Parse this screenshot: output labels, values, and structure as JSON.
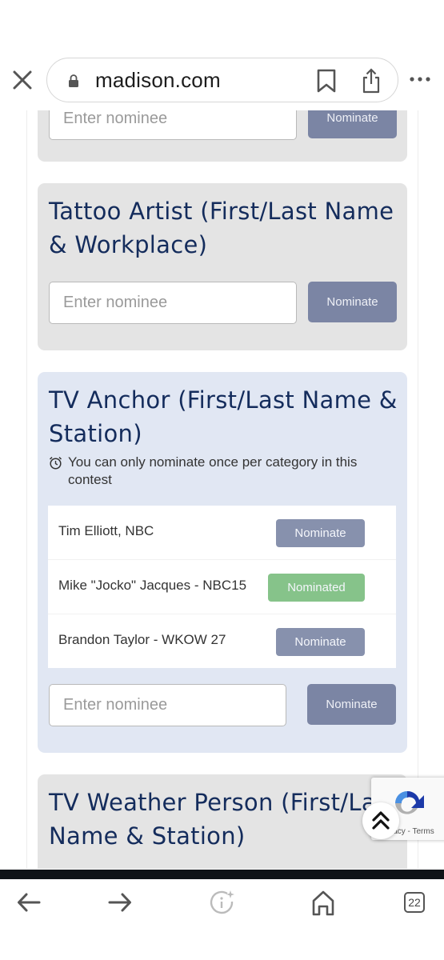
{
  "browser": {
    "url": "madison.com",
    "tabs_count": "22",
    "icons": {
      "close": "close-icon",
      "lock": "lock-icon",
      "bookmark": "bookmark-icon",
      "share": "share-icon",
      "more": "more-icon",
      "back": "arrow-left-icon",
      "forward": "arrow-right-icon",
      "info": "info-sparkle-icon",
      "home": "home-icon",
      "tabs": "tabs-icon"
    }
  },
  "colors": {
    "title": "#142c5c",
    "card_gray": "#e4e4e4",
    "card_active": "#e1e7f3",
    "nominate_button": "#7b85a4",
    "nominated_button": "#86c38a"
  },
  "categories": [
    {
      "title": "",
      "input_placeholder": "Enter nominee",
      "button_label": "Nominate",
      "partial": true
    },
    {
      "title": "Tattoo Artist (First/Last Name & Workplace)",
      "input_placeholder": "Enter nominee",
      "button_label": "Nominate"
    },
    {
      "title": "TV Anchor (First/Last Name & Station)",
      "notice": "You can only nominate once per category in this contest",
      "nominees": [
        {
          "name": "Tim Elliott, NBC",
          "button_label": "Nominate",
          "state": "nominate"
        },
        {
          "name": "Mike \"Jocko\" Jacques - NBC15",
          "button_label": "Nominated",
          "state": "nominated"
        },
        {
          "name": "Brandon Taylor - WKOW 27",
          "button_label": "Nominate",
          "state": "nominate"
        }
      ],
      "input_placeholder": "Enter nominee",
      "button_label": "Nominate"
    },
    {
      "title": "TV Weather Person (First/Last Name & Station)",
      "partial": true
    }
  ],
  "recaptcha": {
    "links": "Privacy - Terms"
  }
}
